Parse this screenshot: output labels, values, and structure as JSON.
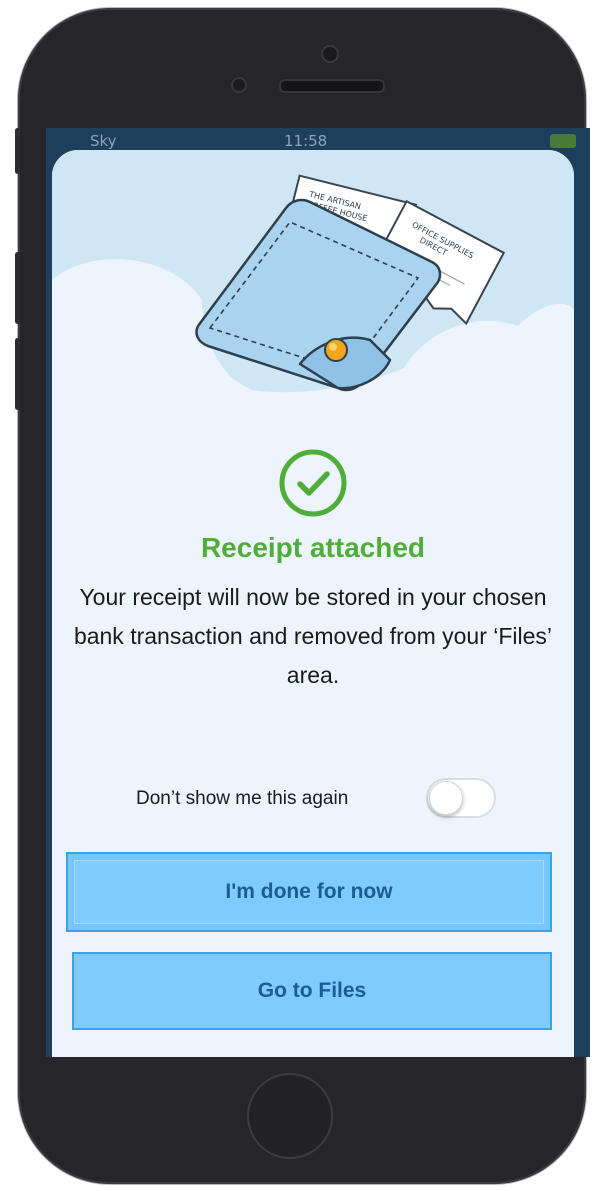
{
  "status_bar": {
    "carrier": "Sky",
    "time": "11:58"
  },
  "illustration": {
    "receipt_1_lines": [
      "THE ARTISAN",
      "COFFEE HOUSE"
    ],
    "receipt_2_lines": [
      "OFFICE SUPPLIES",
      "DIRECT"
    ]
  },
  "dialog": {
    "title": "Receipt attached",
    "body": "Your receipt will now be stored in your chosen bank transaction and removed from your ‘Files’ area.",
    "dont_show_label": "Don’t show me this again",
    "dont_show_enabled": false,
    "primary_button": "I'm done for now",
    "secondary_button": "Go to Files"
  },
  "colors": {
    "success_green": "#4fae3a",
    "button_fill": "#7fcbff",
    "button_text": "#1a5d94",
    "sheet_background": "#edf4fb"
  },
  "icons": {
    "success": "check-circle-icon",
    "hero": "wallet-with-receipts-illustration"
  }
}
